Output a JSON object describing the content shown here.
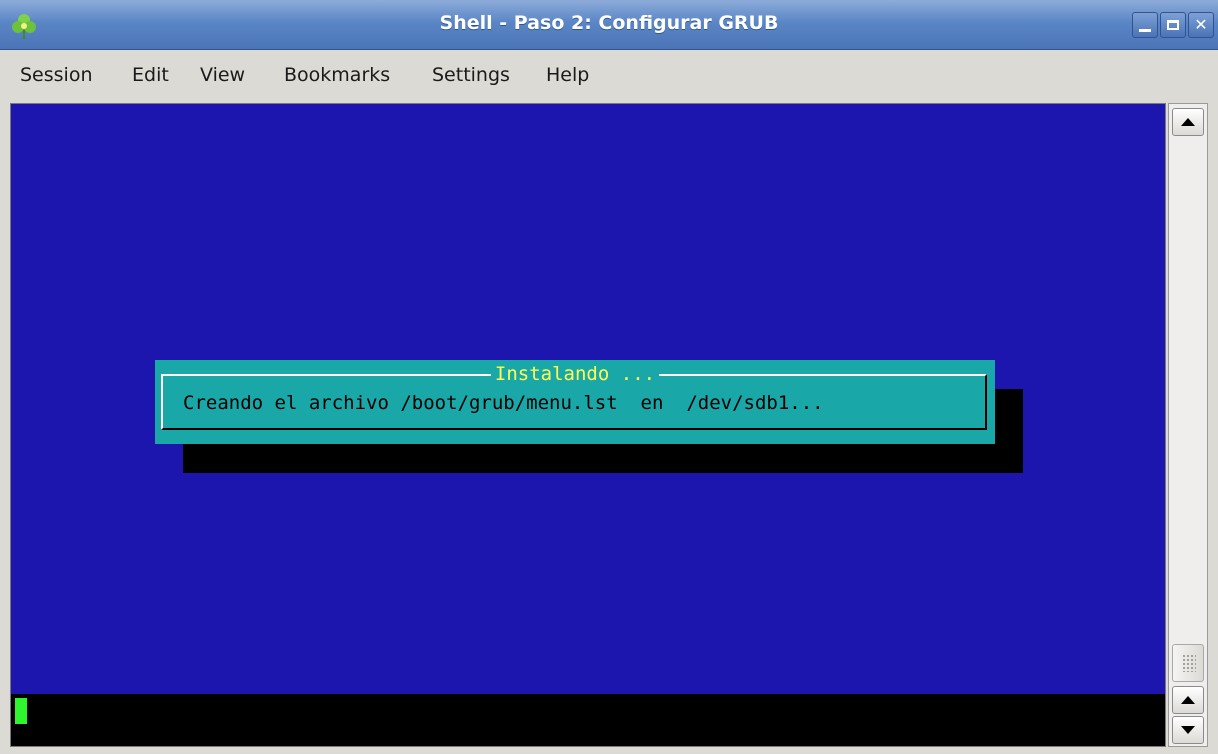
{
  "window": {
    "title": "Shell - Paso 2: Configurar GRUB",
    "app_icon": "clover-icon",
    "buttons": [
      "minimize-icon",
      "maximize-icon",
      "close-icon"
    ]
  },
  "menubar": {
    "items": [
      "Session",
      "Edit",
      "View",
      "Bookmarks",
      "Settings",
      "Help"
    ]
  },
  "dialog": {
    "title": "Instalando ...",
    "message": "Creando el archivo /boot/grub/menu.lst  en  /dev/sdb1..."
  },
  "colors": {
    "terminal_background": "#1c15ae",
    "dialog_background": "#1aa7a7",
    "dialog_title": "#ffff54",
    "cursor": "#2ef52e",
    "titlebar": "#5b86c6"
  }
}
